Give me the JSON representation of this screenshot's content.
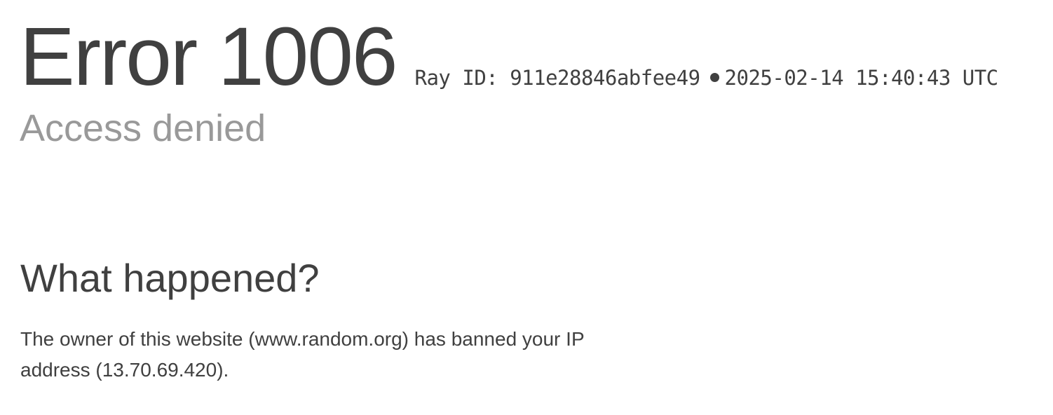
{
  "header": {
    "error_code": "Error 1006",
    "ray_id_label": "Ray ID: 911e28846abfee49",
    "timestamp": "2025-02-14 15:40:43 UTC",
    "subtitle": "Access denied"
  },
  "what_happened": {
    "heading": "What happened?",
    "body": "The owner of this website (www.random.org) has banned your IP address (13.70.69.420)."
  },
  "colors": {
    "text_primary": "#404040",
    "text_muted": "#999999",
    "background": "#ffffff"
  }
}
